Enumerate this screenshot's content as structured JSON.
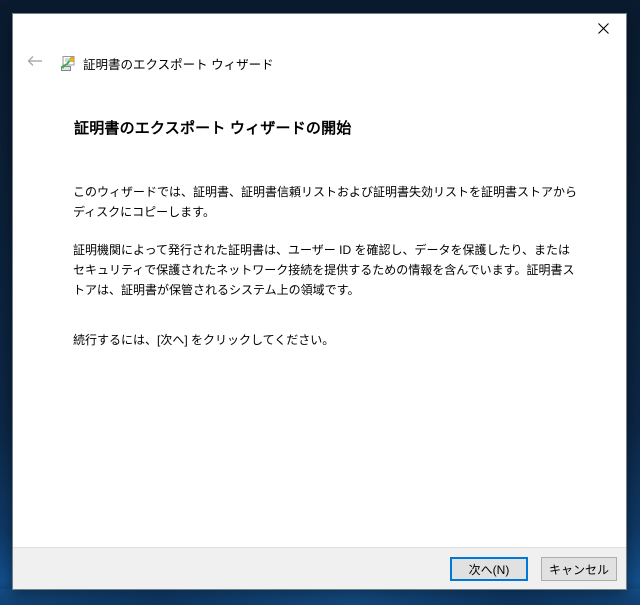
{
  "window": {
    "nav": {
      "title": "証明書のエクスポート ウィザード"
    },
    "heading": "証明書のエクスポート ウィザードの開始",
    "paragraphs": {
      "p1": "このウィザードでは、証明書、証明書信頼リストおよび証明書失効リストを証明書ストアからディスクにコピーします。",
      "p2": "証明機関によって発行された証明書は、ユーザー ID を確認し、データを保護したり、またはセキュリティで保護されたネットワーク接続を提供するための情報を含んでいます。証明書ストアは、証明書が保管されるシステム上の領域です。",
      "p3": "続行するには、[次へ] をクリックしてください。"
    },
    "buttons": {
      "next": "次へ(N)",
      "cancel": "キャンセル"
    },
    "icons": {
      "back": "back-arrow-icon",
      "wizard": "certificate-export-icon",
      "close": "close-icon"
    },
    "colors": {
      "accent": "#0078d7",
      "footer_bg": "#f0f0f0",
      "button_bg": "#e1e1e1",
      "button_border": "#adadad",
      "desktop_top": "#0a1b30",
      "desktop_bottom": "#12508d"
    }
  }
}
